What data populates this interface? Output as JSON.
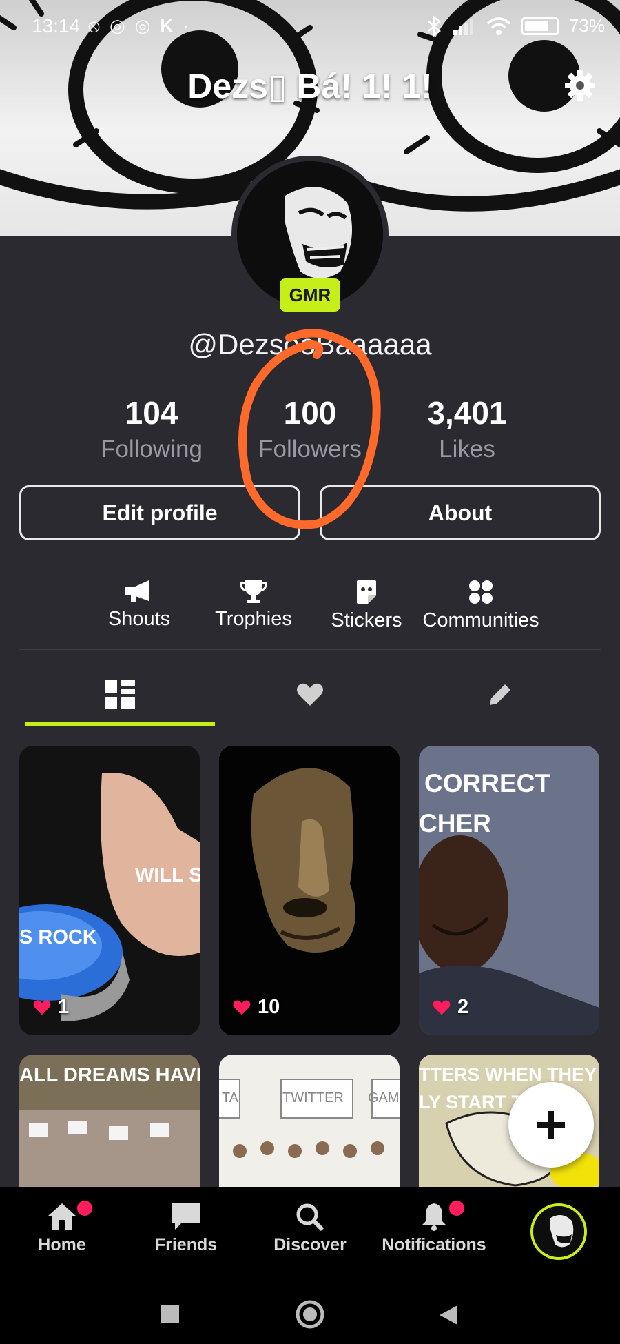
{
  "status_bar": {
    "time": "13:14",
    "left_icons": [
      "mute-icon",
      "chrome-icon",
      "chrome-icon",
      "k-icon"
    ],
    "battery": "73%"
  },
  "header": {
    "title": "Dezs▯ Bá! 1! 1!"
  },
  "profile": {
    "badge": "GMR",
    "username": "@DezsőoBaaaaaa"
  },
  "stats": [
    {
      "value": "104",
      "label": "Following"
    },
    {
      "value": "100",
      "label": "Followers"
    },
    {
      "value": "3,401",
      "label": "Likes"
    }
  ],
  "buttons": {
    "edit": "Edit profile",
    "about": "About"
  },
  "shortcuts": [
    {
      "label": "Shouts",
      "icon": "megaphone-icon"
    },
    {
      "label": "Trophies",
      "icon": "trophy-icon"
    },
    {
      "label": "Stickers",
      "icon": "sticker-icon"
    },
    {
      "label": "Communities",
      "icon": "communities-icon"
    }
  ],
  "tabs": [
    {
      "icon": "grid-icon",
      "active": true
    },
    {
      "icon": "heart-icon",
      "active": false
    },
    {
      "icon": "pencil-icon",
      "active": false
    }
  ],
  "posts": [
    {
      "likes": "1",
      "captions": [
        "WILL S",
        "S ROCK"
      ]
    },
    {
      "likes": "10",
      "captions": []
    },
    {
      "likes": "2",
      "captions": [
        "CORRECT",
        "CHER"
      ]
    },
    {
      "captions": [
        "ALL DREAMS HAVE"
      ]
    },
    {
      "captions": [
        "TA",
        "TWITTER",
        "GAM"
      ]
    },
    {
      "captions": [
        "TTERS WHEN THEY",
        "LY START T"
      ]
    }
  ],
  "bottom_nav": [
    {
      "label": "Home",
      "icon": "home-icon",
      "dot": true
    },
    {
      "label": "Friends",
      "icon": "chat-icon",
      "dot": false
    },
    {
      "label": "Discover",
      "icon": "search-icon",
      "dot": false
    },
    {
      "label": "Notifications",
      "icon": "bell-icon",
      "dot": true
    }
  ],
  "colors": {
    "accent": "#c6ef19",
    "background": "#2b2a31",
    "like": "#ff1d5e",
    "annotation": "#ff6a2b"
  }
}
